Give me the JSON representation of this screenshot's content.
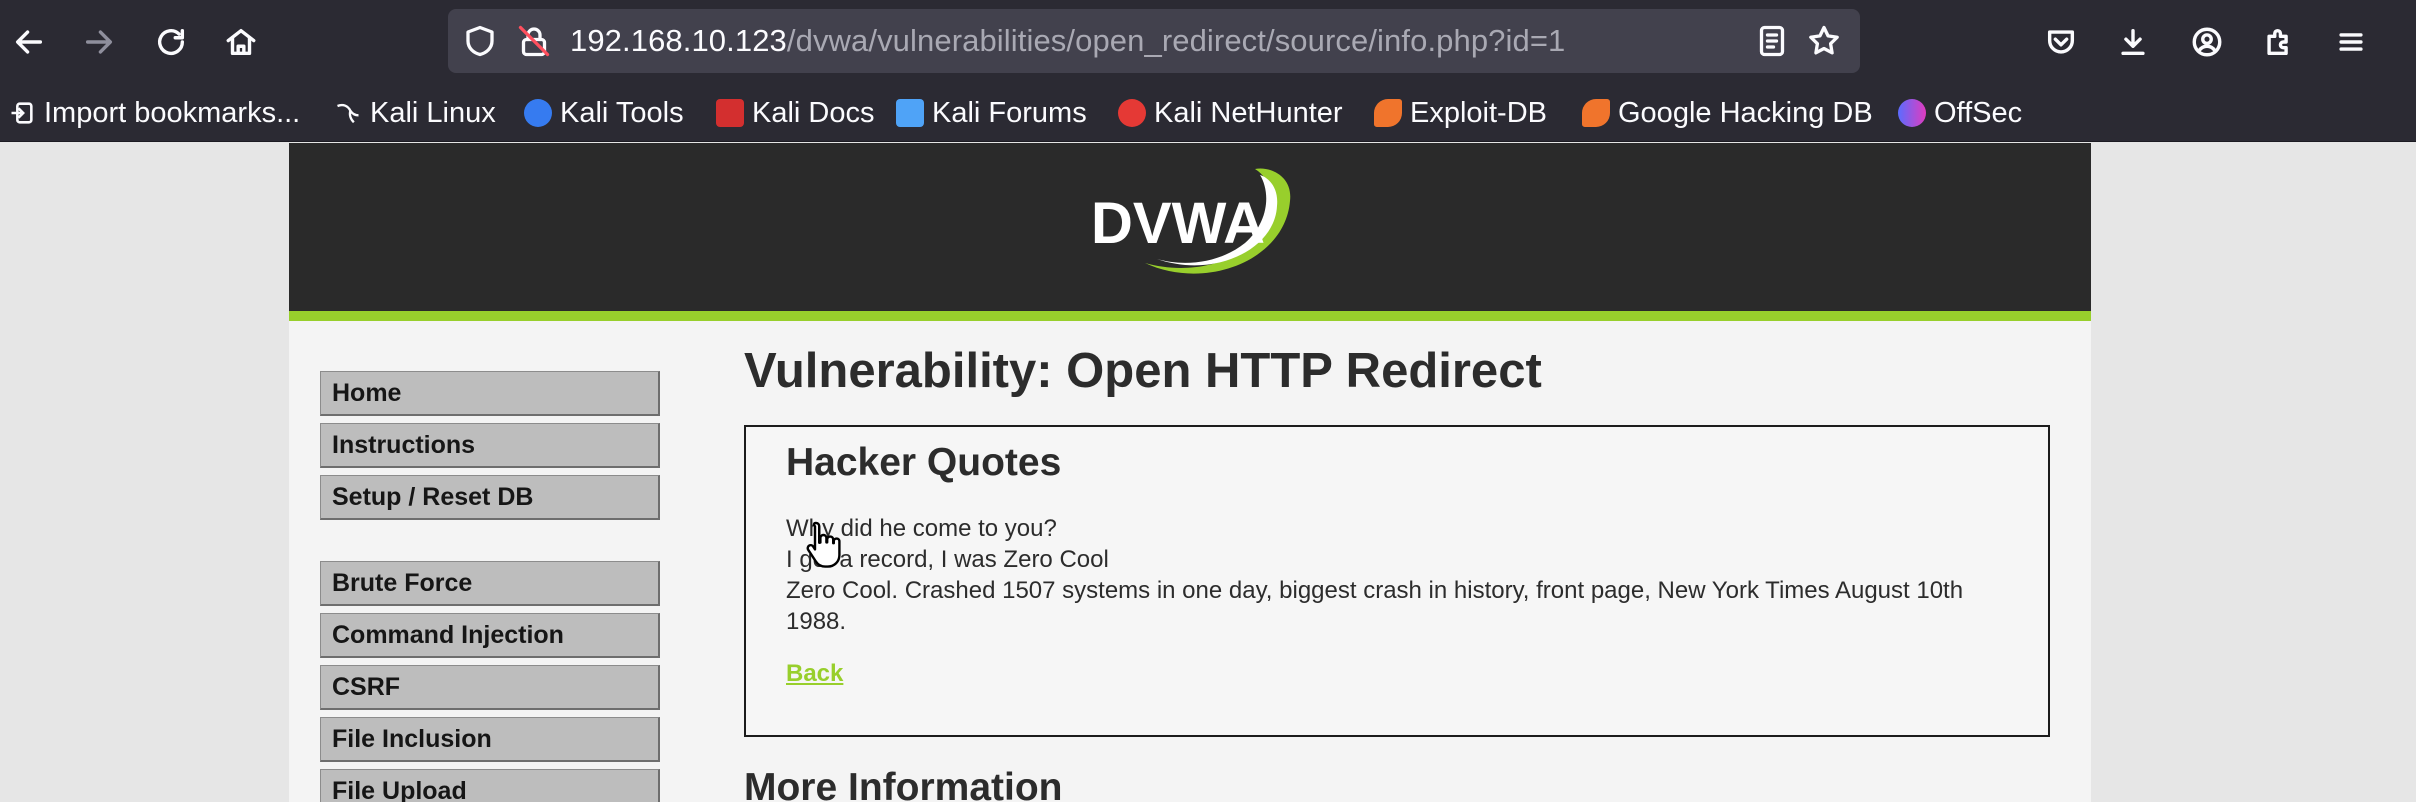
{
  "browser": {
    "url_host": "192.168.10.123",
    "url_path": "/dvwa/vulnerabilities/open_redirect/source/info.php?id=1",
    "bookmarks": [
      {
        "label": "Import bookmarks...",
        "icon": "import-icon",
        "color": "#fbfbfe"
      },
      {
        "label": "Kali Linux",
        "icon": "kali-dragon-icon",
        "color": "#ffffff"
      },
      {
        "label": "Kali Tools",
        "icon": "kali-tools-icon",
        "color": "#367bf0"
      },
      {
        "label": "Kali Docs",
        "icon": "kali-docs-icon",
        "color": "#d32f2f"
      },
      {
        "label": "Kali Forums",
        "icon": "kali-forums-icon",
        "color": "#4fa3f7"
      },
      {
        "label": "Kali NetHunter",
        "icon": "nethunter-icon",
        "color": "#e53935"
      },
      {
        "label": "Exploit-DB",
        "icon": "exploit-db-icon",
        "color": "#f0742c"
      },
      {
        "label": "Google Hacking DB",
        "icon": "ghdb-icon",
        "color": "#f0742c"
      },
      {
        "label": "OffSec",
        "icon": "offsec-icon",
        "color": "#5b6cff"
      }
    ]
  },
  "dvwa": {
    "logo_text": "DVWA",
    "menu": [
      "Home",
      "Instructions",
      "Setup / Reset DB",
      "Brute Force",
      "Command Injection",
      "CSRF",
      "File Inclusion",
      "File Upload"
    ],
    "page_title": "Vulnerability: Open HTTP Redirect",
    "box_title": "Hacker Quotes",
    "quote_lines": [
      "Why did he come to you?",
      "I got a record, I was Zero Cool",
      "Zero Cool. Crashed 1507 systems in one day, biggest crash in history, front page, New York Times August 10th 1988."
    ],
    "back_link": "Back",
    "more_info_title": "More Information",
    "accent_color": "#98cf2c"
  }
}
